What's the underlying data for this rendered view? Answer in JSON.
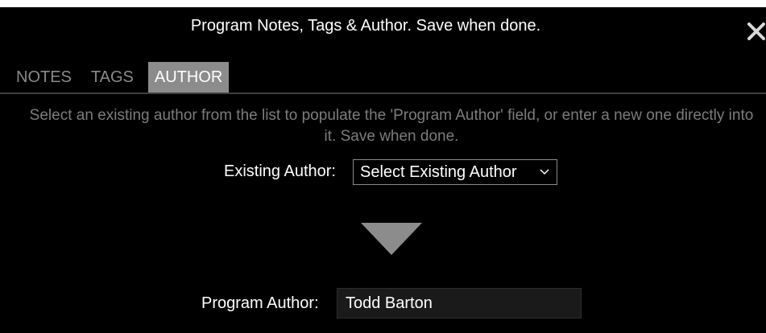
{
  "dialog": {
    "title": "Program Notes, Tags & Author. Save when done.",
    "close_icon": "close-icon"
  },
  "tabs": [
    {
      "label": "NOTES",
      "active": false
    },
    {
      "label": "TAGS",
      "active": false
    },
    {
      "label": "AUTHOR",
      "active": true
    }
  ],
  "author_panel": {
    "instructions": "Select an existing author from the list to populate the 'Program Author' field, or enter a new one directly into it. Save when done.",
    "existing_label": "Existing Author:",
    "existing_select_value": "Select Existing Author",
    "arrow_icon": "arrow-down-icon",
    "program_author_label": "Program Author:",
    "program_author_value": "Todd Barton"
  },
  "colors": {
    "background": "#000000",
    "active_tab": "#8c8c8c",
    "inactive_tab_text": "#8a8a8a",
    "instruction_text": "#7c7c7c"
  }
}
